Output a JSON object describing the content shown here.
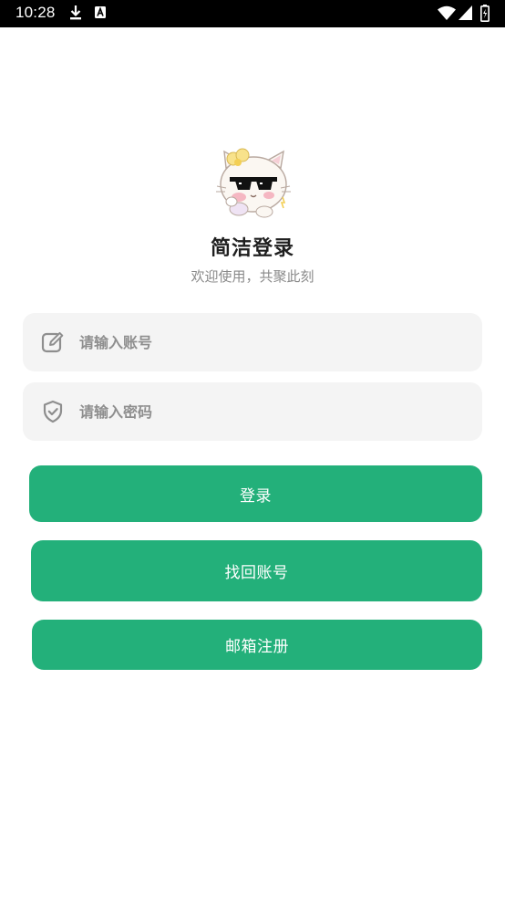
{
  "status_bar": {
    "time": "10:28",
    "icons": [
      "download-icon",
      "a-text-icon",
      "wifi-icon",
      "signal-icon",
      "battery-icon"
    ]
  },
  "header": {
    "title": "简洁登录",
    "subtitle": "欢迎使用，共聚此刻",
    "mascot": "cat-sunglasses-icon"
  },
  "form": {
    "account": {
      "placeholder": "请输入账号",
      "value": "",
      "icon": "edit-icon"
    },
    "password": {
      "placeholder": "请输入密码",
      "value": "",
      "icon": "shield-check-icon"
    }
  },
  "buttons": {
    "login": "登录",
    "recover": "找回账号",
    "register": "邮箱注册"
  },
  "colors": {
    "accent": "#23b07a",
    "field_bg": "#f4f4f4",
    "title": "#1f1f1f",
    "subtitle": "#8a8a8a",
    "placeholder": "#8e8e8e",
    "status_bar": "#000000"
  }
}
